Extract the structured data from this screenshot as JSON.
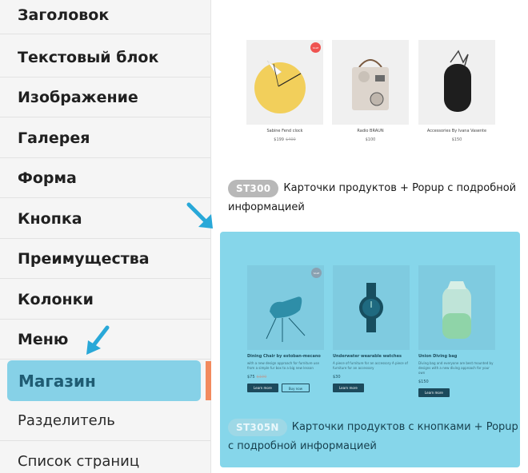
{
  "sidebar": {
    "items": [
      {
        "label": "Заголовок"
      },
      {
        "label": "Текстовый блок"
      },
      {
        "label": "Изображение"
      },
      {
        "label": "Галерея"
      },
      {
        "label": "Форма"
      },
      {
        "label": "Кнопка"
      },
      {
        "label": "Преимущества"
      },
      {
        "label": "Колонки"
      },
      {
        "label": "Меню"
      },
      {
        "label": "Магазин"
      },
      {
        "label": "Разделитель"
      },
      {
        "label": "Список страниц"
      }
    ]
  },
  "block1": {
    "products": [
      {
        "name": "Sabine Fend clock",
        "price": "$199",
        "old_price": "$400",
        "badge": "SALE"
      },
      {
        "name": "Radio BRAUN",
        "price": "$100"
      },
      {
        "name": "Accessories By Ivana Vasente",
        "price": "$150"
      }
    ],
    "code": "ST300",
    "caption": "Карточки продуктов + Popup с подробной информацией"
  },
  "block2": {
    "products": [
      {
        "name": "Dining Chair by estoban-mecano",
        "desc": "with a new design approach for furniture use from a simple fur box to a big new lesson",
        "price": "$75",
        "old_price": "$100",
        "badge": "SALE",
        "btn1": "Learn more",
        "btn2": "Buy now"
      },
      {
        "name": "Underwater wearable watches",
        "desc": "A piece of furniture for an accessory A piece of furniture for an accessory",
        "price": "$30",
        "btn1": "Learn more"
      },
      {
        "name": "Union Diving bag",
        "desc": "Diving bag and everyone are best mounted by designs with a new diving approach for your own",
        "price": "$150",
        "btn1": "Learn more"
      }
    ],
    "code": "ST305N",
    "caption": "Карточки продуктов с кнопками + Popup с подробной информацией"
  },
  "colors": {
    "accent": "#86d1e7",
    "active_text": "#1f5c73",
    "marker": "#f28a5e",
    "arrow": "#29a8d8"
  },
  "icons": [
    "arrow-down-right-icon",
    "arrow-down-left-icon"
  ]
}
